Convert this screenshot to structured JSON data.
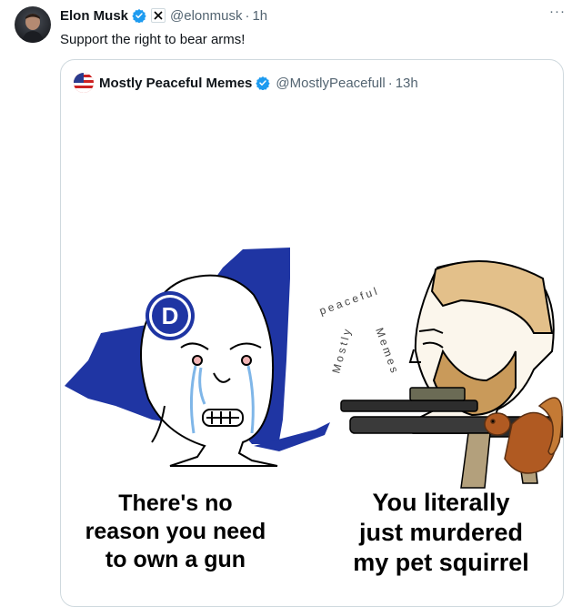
{
  "tweet": {
    "author": "Elon Musk",
    "handle": "@elonmusk",
    "dot": "·",
    "time": "1h",
    "text": "Support the right to bear arms!",
    "more": "···"
  },
  "quote": {
    "author": "Mostly Peaceful Memes",
    "handle": "@MostlyPeacefull",
    "dot": "·",
    "time": "13h",
    "meme": {
      "party_letter": "D",
      "watermark_top": "peaceful",
      "watermark_left": "Mostly",
      "watermark_right": "Memes",
      "left_caption": [
        "There's no",
        "reason you need",
        "to own a gun"
      ],
      "right_caption": [
        "You literally",
        "just murdered",
        "my pet squirrel"
      ]
    }
  },
  "colors": {
    "verified": "#1d9bf0",
    "state_blue": "#1f35a3",
    "tear_blue": "#7fb6e8",
    "text_secondary": "#536471"
  },
  "icons": [
    "verified-badge-icon",
    "x-affiliate-icon",
    "more-icon"
  ]
}
